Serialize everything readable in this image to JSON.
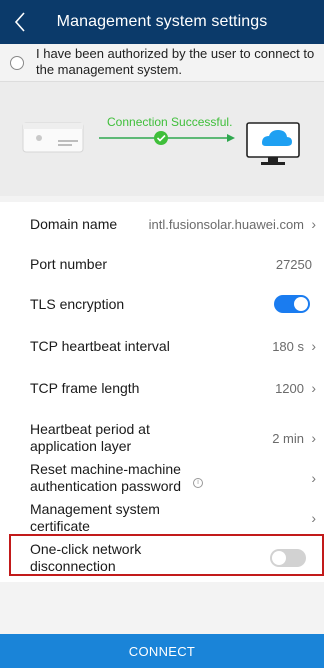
{
  "header": {
    "title": "Management system settings",
    "back_icon": "chevron-left-icon"
  },
  "authorization": {
    "text": "I have been authorized by the user to connect to the management system.",
    "checked": false
  },
  "connection": {
    "status_text": "Connection Successful.",
    "status_color": "#3fbf3a",
    "source_icon": "inverter-device-icon",
    "target_icon": "cloud-monitor-icon"
  },
  "settings": {
    "domain": {
      "label": "Domain name",
      "value": "intl.fusionsolar.huawei.com"
    },
    "port": {
      "label": "Port number",
      "value": "27250"
    },
    "tls": {
      "label": "TLS encryption",
      "enabled": true
    },
    "tcp_heartbeat": {
      "label": "TCP heartbeat interval",
      "value": "180 s"
    },
    "tcp_frame": {
      "label": "TCP frame length",
      "value": "1200"
    },
    "app_heartbeat": {
      "label": "Heartbeat period at application layer",
      "value": "2 min"
    },
    "reset_password": {
      "label": "Reset machine-machine authentication password",
      "info_icon": "i"
    },
    "certificate": {
      "label": "Management system certificate"
    },
    "one_click": {
      "label": "One-click network disconnection",
      "enabled": false
    }
  },
  "footer": {
    "connect_label": "CONNECT"
  },
  "colors": {
    "header_bg": "#0b3a6a",
    "toggle_on": "#1a7cf0",
    "button_bg": "#1a84d8",
    "highlight_border": "#c21a1a"
  }
}
